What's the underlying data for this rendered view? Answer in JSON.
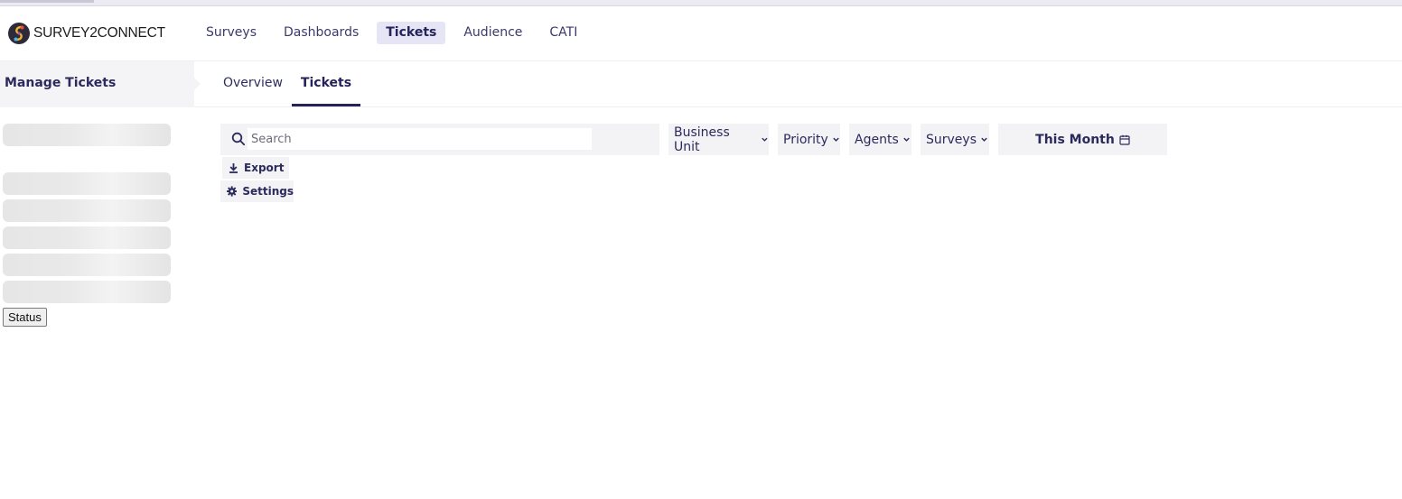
{
  "brand": {
    "name": "SURVEY2CONNECT",
    "logo_icon": "survey2connect-logo-icon"
  },
  "main_nav": {
    "items": [
      {
        "label": "Surveys",
        "active": false
      },
      {
        "label": "Dashboards",
        "active": false
      },
      {
        "label": "Tickets",
        "active": true
      },
      {
        "label": "Audience",
        "active": false
      },
      {
        "label": "CATI",
        "active": false
      }
    ]
  },
  "sidebar": {
    "title": "Manage Tickets",
    "status_button": "Status"
  },
  "subtabs": {
    "items": [
      {
        "label": "Overview",
        "active": false
      },
      {
        "label": "Tickets",
        "active": true
      }
    ]
  },
  "filters": {
    "search_placeholder": "Search",
    "search_value": "",
    "business_unit": "Business Unit",
    "priority": "Priority",
    "agents": "Agents",
    "surveys": "Surveys",
    "date_range": "This Month",
    "icons": {
      "search": "search-icon",
      "chevron": "chevron-down-icon",
      "calendar": "calendar-icon"
    }
  },
  "actions": {
    "export": "Export",
    "settings": "Settings",
    "icons": {
      "export": "download-icon",
      "settings": "gear-icon"
    }
  },
  "colors": {
    "accent": "#25235a",
    "active_nav_bg": "#e6e5f6",
    "panel_bg": "#f3f3f6"
  }
}
